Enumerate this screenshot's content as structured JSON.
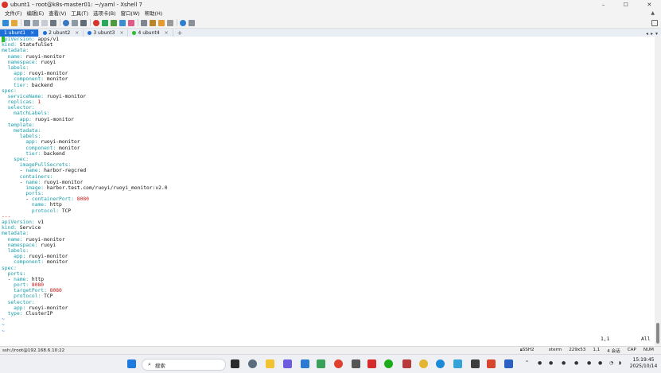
{
  "window": {
    "title": "ubunt1 - root@k8s-master01: ~/yaml - Xshell 7"
  },
  "window_buttons": {
    "minimize": "–",
    "maximize": "☐",
    "close": "✕"
  },
  "menu": [
    "文件(F)",
    "编辑(E)",
    "查看(V)",
    "工具(T)",
    "选项卡(B)",
    "窗口(W)",
    "帮助(H)"
  ],
  "tabs": [
    {
      "label": "1 ubunt1",
      "active": true,
      "dot": ""
    },
    {
      "label": "2 ubunt2",
      "active": false,
      "dot": "#1c6fd8"
    },
    {
      "label": "3 ubunt3",
      "active": false,
      "dot": "#1c6fd8"
    },
    {
      "label": "4 ubunt4",
      "active": false,
      "dot": "#2dbd2d"
    }
  ],
  "tab_add": "+",
  "terminal": {
    "lines": [
      [
        [
          "cursor",
          "a"
        ],
        [
          "k",
          "piVersion: "
        ],
        [
          "v",
          "apps/v1"
        ]
      ],
      [
        [
          "k",
          "kind: "
        ],
        [
          "v",
          "StatefulSet"
        ]
      ],
      [
        [
          "k",
          "metadata:"
        ]
      ],
      [
        [
          "k",
          "  name: "
        ],
        [
          "v",
          "ruoyi-monitor"
        ]
      ],
      [
        [
          "k",
          "  namespace: "
        ],
        [
          "v",
          "ruoyi"
        ]
      ],
      [
        [
          "k",
          "  labels:"
        ]
      ],
      [
        [
          "k",
          "    app: "
        ],
        [
          "v",
          "ruoyi-monitor"
        ]
      ],
      [
        [
          "k",
          "    component: "
        ],
        [
          "v",
          "monitor"
        ]
      ],
      [
        [
          "k",
          "    tier: "
        ],
        [
          "v",
          "backend"
        ]
      ],
      [
        [
          "k",
          "spec:"
        ]
      ],
      [
        [
          "k",
          "  serviceName: "
        ],
        [
          "v",
          "ruoyi-monitor"
        ]
      ],
      [
        [
          "k",
          "  replicas: "
        ],
        [
          "n",
          "1"
        ]
      ],
      [
        [
          "k",
          "  selector:"
        ]
      ],
      [
        [
          "k",
          "    matchLabels:"
        ]
      ],
      [
        [
          "k",
          "      app: "
        ],
        [
          "v",
          "ruoyi-monitor"
        ]
      ],
      [
        [
          "k",
          "  template:"
        ]
      ],
      [
        [
          "k",
          "    metadata:"
        ]
      ],
      [
        [
          "k",
          "      labels:"
        ]
      ],
      [
        [
          "k",
          "        app: "
        ],
        [
          "v",
          "ruoyi-monitor"
        ]
      ],
      [
        [
          "k",
          "        component: "
        ],
        [
          "v",
          "monitor"
        ]
      ],
      [
        [
          "k",
          "        tier: "
        ],
        [
          "v",
          "backend"
        ]
      ],
      [
        [
          "k",
          "    spec:"
        ]
      ],
      [
        [
          "k",
          "      imagePullSecrets:"
        ]
      ],
      [
        [
          "v",
          "      - "
        ],
        [
          "k",
          "name: "
        ],
        [
          "v",
          "harbor-regcred"
        ]
      ],
      [
        [
          "k",
          "      containers:"
        ]
      ],
      [
        [
          "v",
          "      - "
        ],
        [
          "k",
          "name: "
        ],
        [
          "v",
          "ruoyi-monitor"
        ]
      ],
      [
        [
          "k",
          "        image: "
        ],
        [
          "v",
          "harbor.test.com/ruoyi/ruoyi_monitor:v2.0"
        ]
      ],
      [
        [
          "k",
          "        ports:"
        ]
      ],
      [
        [
          "v",
          "        - "
        ],
        [
          "k",
          "containerPort: "
        ],
        [
          "n",
          "8080"
        ]
      ],
      [
        [
          "k",
          "          name: "
        ],
        [
          "v",
          "http"
        ]
      ],
      [
        [
          "k",
          "          protocol: "
        ],
        [
          "v",
          "TCP"
        ]
      ],
      [
        [
          "s",
          "---"
        ]
      ],
      [
        [
          "k",
          "apiVersion: "
        ],
        [
          "v",
          "v1"
        ]
      ],
      [
        [
          "k",
          "kind: "
        ],
        [
          "v",
          "Service"
        ]
      ],
      [
        [
          "k",
          "metadata:"
        ]
      ],
      [
        [
          "k",
          "  name: "
        ],
        [
          "v",
          "ruoyi-monitor"
        ]
      ],
      [
        [
          "k",
          "  namespace: "
        ],
        [
          "v",
          "ruoyi"
        ]
      ],
      [
        [
          "k",
          "  labels:"
        ]
      ],
      [
        [
          "k",
          "    app: "
        ],
        [
          "v",
          "ruoyi-monitor"
        ]
      ],
      [
        [
          "k",
          "    component: "
        ],
        [
          "v",
          "monitor"
        ]
      ],
      [
        [
          "k",
          "spec:"
        ]
      ],
      [
        [
          "k",
          "  ports:"
        ]
      ],
      [
        [
          "v",
          "  - "
        ],
        [
          "k",
          "name: "
        ],
        [
          "v",
          "http"
        ]
      ],
      [
        [
          "k",
          "    port: "
        ],
        [
          "n",
          "8080"
        ]
      ],
      [
        [
          "k",
          "    targetPort: "
        ],
        [
          "n",
          "8080"
        ]
      ],
      [
        [
          "k",
          "    protocol: "
        ],
        [
          "v",
          "TCP"
        ]
      ],
      [
        [
          "k",
          "  selector:"
        ]
      ],
      [
        [
          "k",
          "    app: "
        ],
        [
          "v",
          "ruoyi-monitor"
        ]
      ],
      [
        [
          "k",
          "  type: "
        ],
        [
          "v",
          "ClusterIP"
        ]
      ],
      [
        [
          "t",
          "~"
        ]
      ],
      [
        [
          "t",
          "~"
        ]
      ],
      [
        [
          "t",
          "~"
        ]
      ]
    ],
    "position": "1,1",
    "scroll": "All"
  },
  "statusbar": {
    "session": "ssh://root@192.168.6.10:22",
    "protocol": "SSH2",
    "terminal_type": "xterm",
    "size": "229x53",
    "cursor": "1,1",
    "sessions": "4 会话",
    "caps": "CAP",
    "num": "NUM"
  },
  "taskbar": {
    "search_placeholder": "搜索",
    "time": "15:19:45",
    "date": "2025/10/14"
  },
  "colors": {
    "yaml_key": "#179ca9",
    "yaml_number": "#cc1212",
    "tab_active": "#1c6fd8",
    "cursor": "#2dbd2d"
  }
}
